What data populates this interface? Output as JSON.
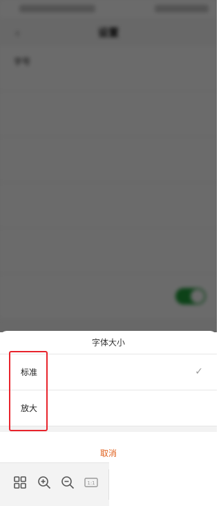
{
  "background": {
    "nav_back": "‹",
    "title": "设置",
    "rows": [
      {
        "title": "字号",
        "subtitle": "",
        "value": ""
      },
      {
        "title": "",
        "subtitle": "",
        "value": ""
      },
      {
        "title": "",
        "subtitle": "",
        "value": ""
      },
      {
        "title": "",
        "subtitle": "",
        "value": ""
      },
      {
        "title": "",
        "subtitle": "",
        "value": ""
      }
    ],
    "toggle_on": true,
    "toggle_color": "#1f9d3a"
  },
  "sheet": {
    "title": "字体大小",
    "options": [
      {
        "label": "标准",
        "selected": true
      },
      {
        "label": "放大",
        "selected": false
      }
    ],
    "check_glyph": "✓",
    "cancel_label": "取消",
    "cancel_color": "#e0621f"
  },
  "highlight_color": "#e8222b",
  "toolbar": {
    "items": [
      "grid-icon",
      "zoom-in-icon",
      "zoom-out-icon",
      "actual-size-icon"
    ],
    "actual_size_label": "1:1"
  }
}
